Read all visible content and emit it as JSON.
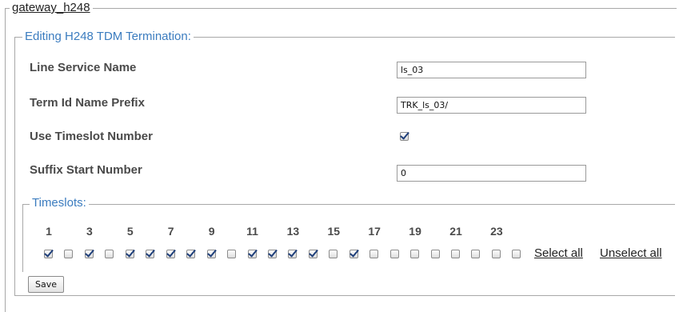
{
  "outer_legend": "gateway_h248",
  "form": {
    "legend": "Editing H248 TDM Termination:",
    "fields": [
      {
        "label": "Line Service Name",
        "value": "ls_03"
      },
      {
        "label": "Term Id Name Prefix",
        "value": "TRK_ls_03/"
      },
      {
        "label": "Use Timeslot Number",
        "checked": true
      },
      {
        "label": "Suffix Start Number",
        "value": "0"
      }
    ]
  },
  "timeslots": {
    "legend": "Timeslots:",
    "numbers": [
      "1",
      "3",
      "5",
      "7",
      "9",
      "11",
      "13",
      "15",
      "17",
      "19",
      "21",
      "23"
    ],
    "checked": [
      true,
      false,
      true,
      false,
      true,
      true,
      true,
      true,
      true,
      false,
      true,
      true,
      true,
      true,
      false,
      true,
      false,
      false,
      false,
      false,
      false,
      false,
      false,
      false
    ],
    "select_all": "Select all",
    "unselect_all": "Unselect all"
  },
  "save_label": "Save"
}
